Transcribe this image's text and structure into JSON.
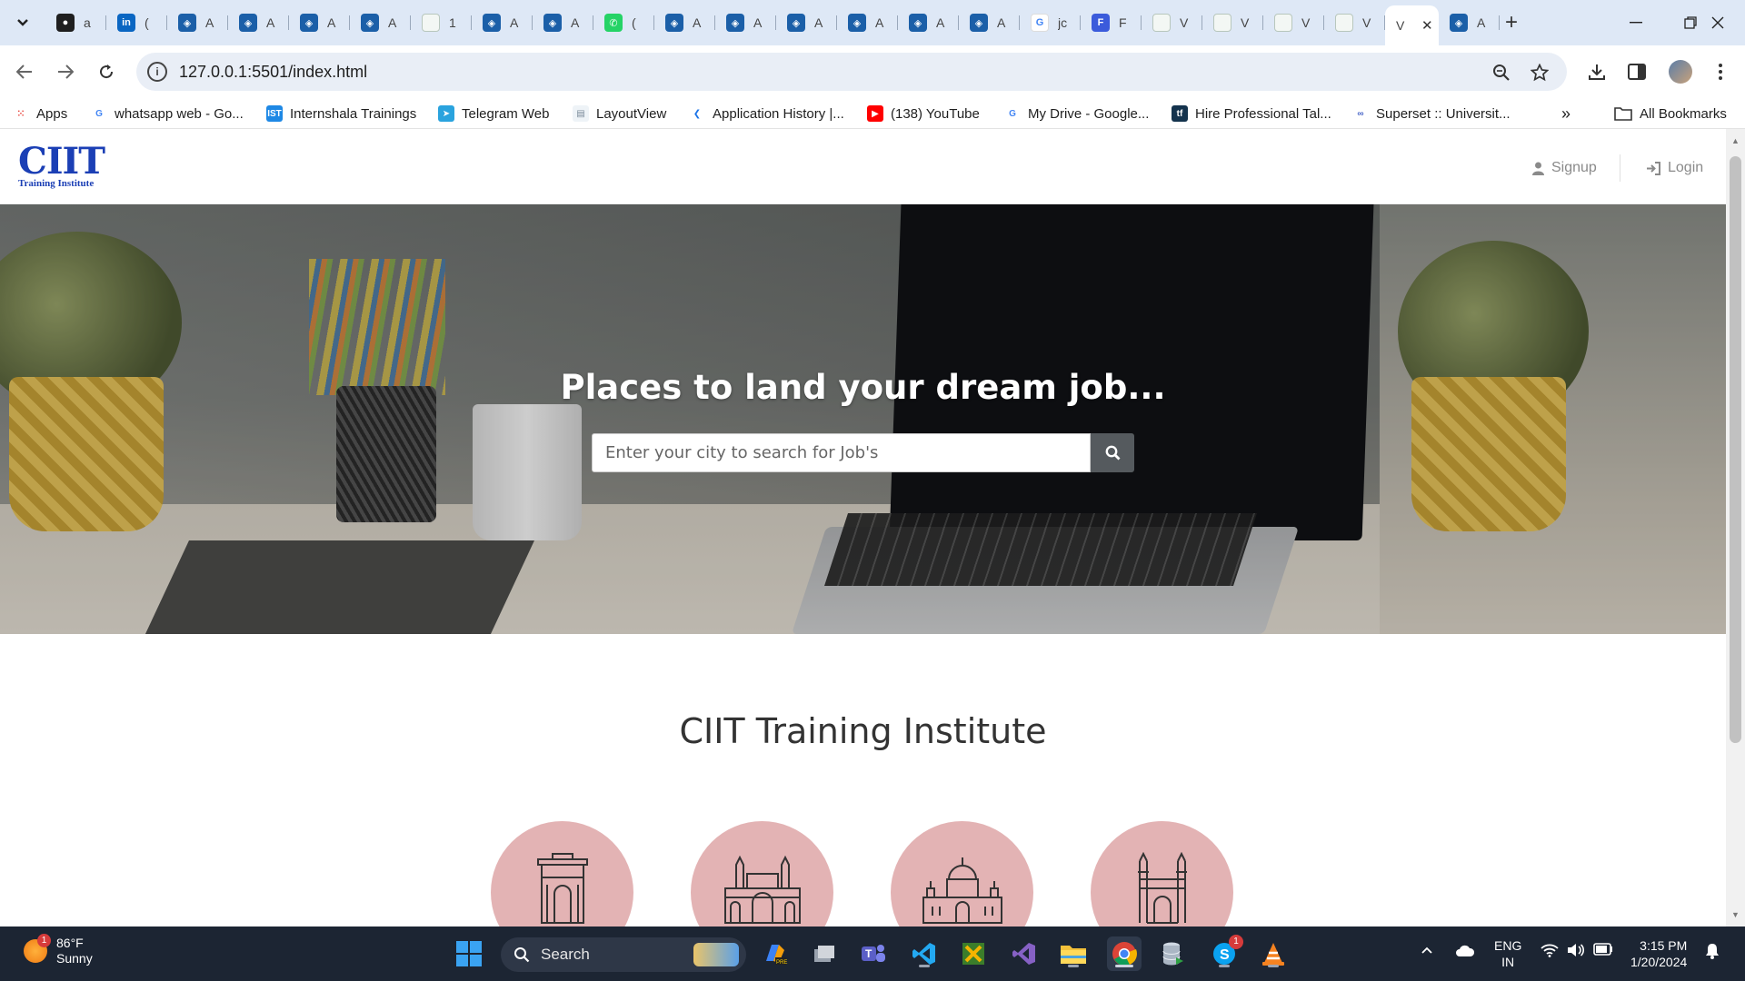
{
  "browser": {
    "tabs": [
      {
        "letter": "a",
        "icon": "github-icon"
      },
      {
        "letter": "(",
        "icon": "linkedin-icon"
      },
      {
        "letter": "A",
        "icon": "app-icon"
      },
      {
        "letter": "A",
        "icon": "app-icon"
      },
      {
        "letter": "A",
        "icon": "app-icon"
      },
      {
        "letter": "A",
        "icon": "app-icon"
      },
      {
        "letter": "1",
        "icon": "page-icon"
      },
      {
        "letter": "A",
        "icon": "app-icon"
      },
      {
        "letter": "A",
        "icon": "app-icon"
      },
      {
        "letter": "(",
        "icon": "whatsapp-icon"
      },
      {
        "letter": "A",
        "icon": "app-icon"
      },
      {
        "letter": "A",
        "icon": "app-icon"
      },
      {
        "letter": "A",
        "icon": "app-icon"
      },
      {
        "letter": "A",
        "icon": "app-icon"
      },
      {
        "letter": "A",
        "icon": "app-icon"
      },
      {
        "letter": "A",
        "icon": "app-icon"
      },
      {
        "letter": "jc",
        "icon": "google-icon"
      },
      {
        "letter": "F",
        "icon": "forms-icon"
      },
      {
        "letter": "V",
        "icon": "page-icon"
      },
      {
        "letter": "V",
        "icon": "page-icon"
      },
      {
        "letter": "V",
        "icon": "page-icon"
      },
      {
        "letter": "V",
        "icon": "page-icon"
      }
    ],
    "active_tab": {
      "letter": "V",
      "close": "✕"
    },
    "last_tab": {
      "letter": "A",
      "icon": "app-icon"
    },
    "new_tab": "+",
    "url": "127.0.0.1:5501/index.html",
    "bookmarks": [
      {
        "label": "Apps",
        "icon": "apps-grid-icon"
      },
      {
        "label": "whatsapp web - Go...",
        "icon": "google-icon"
      },
      {
        "label": "Internshala Trainings",
        "icon": "ist-icon"
      },
      {
        "label": "Telegram Web",
        "icon": "telegram-icon"
      },
      {
        "label": "LayoutView",
        "icon": "page-icon"
      },
      {
        "label": "Application History |...",
        "icon": "kaggle-icon"
      },
      {
        "label": "(138) YouTube",
        "icon": "youtube-icon"
      },
      {
        "label": "My Drive - Google...",
        "icon": "google-icon"
      },
      {
        "label": "Hire Professional Tal...",
        "icon": "tf-icon"
      },
      {
        "label": "Superset :: Universit...",
        "icon": "superset-icon"
      }
    ],
    "all_bookmarks": "All Bookmarks"
  },
  "site": {
    "logo_big": "CIIT",
    "logo_small": "Training Institute",
    "signup": "Signup",
    "login": "Login",
    "hero_title": "Places to land your dream job...",
    "search_placeholder": "Enter your city to search for Job's",
    "section_title": "CIIT Training Institute",
    "circles": [
      "india-gate-icon",
      "gateway-of-india-icon",
      "palace-icon",
      "charminar-icon"
    ],
    "circle_color": "#e3b3b4"
  },
  "taskbar": {
    "temperature": "86°F",
    "condition": "Sunny",
    "weather_badge": "1",
    "search": "Search",
    "lang_top": "ENG",
    "lang_bottom": "IN",
    "time": "3:15 PM",
    "date": "1/20/2024",
    "skype_badge": "1"
  }
}
